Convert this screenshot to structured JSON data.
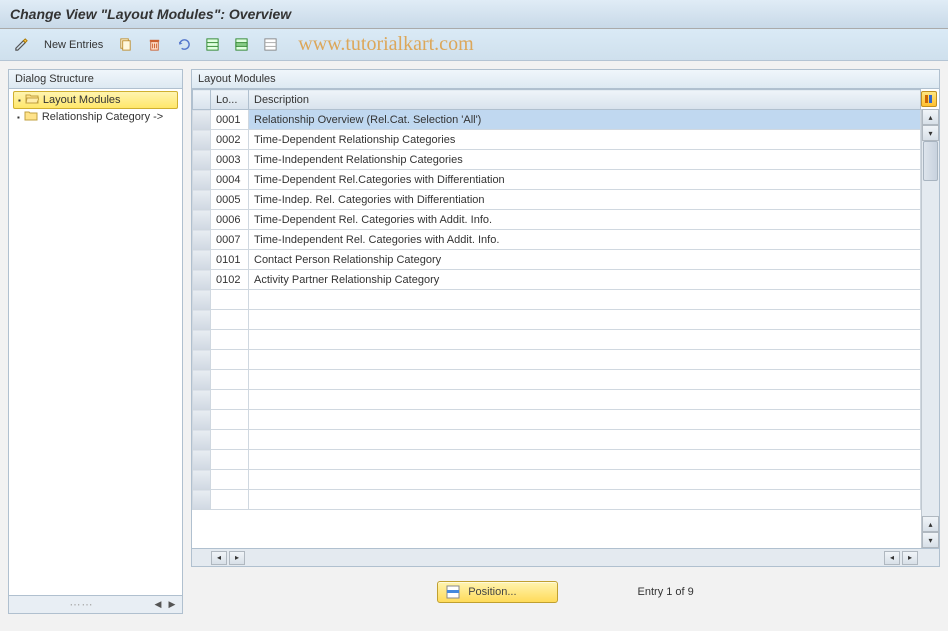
{
  "titlebar": {
    "text": "Change View \"Layout Modules\": Overview"
  },
  "toolbar": {
    "new_entries_label": "New Entries"
  },
  "watermark": "www.tutorialkart.com",
  "dialog_structure": {
    "header": "Dialog Structure",
    "items": [
      {
        "label": "Layout Modules",
        "selected": true,
        "open": true
      },
      {
        "label": "Relationship Category ->",
        "selected": false,
        "open": false
      }
    ]
  },
  "table": {
    "header": "Layout Modules",
    "columns": {
      "lo": "Lo...",
      "description": "Description"
    },
    "rows": [
      {
        "lo": "0001",
        "desc": "Relationship Overview (Rel.Cat. Selection 'All')",
        "selected": true
      },
      {
        "lo": "0002",
        "desc": "Time-Dependent Relationship Categories",
        "selected": false
      },
      {
        "lo": "0003",
        "desc": "Time-Independent Relationship Categories",
        "selected": false
      },
      {
        "lo": "0004",
        "desc": "Time-Dependent Rel.Categories with Differentiation",
        "selected": false
      },
      {
        "lo": "0005",
        "desc": "Time-Indep. Rel. Categories with Differentiation",
        "selected": false
      },
      {
        "lo": "0006",
        "desc": "Time-Dependent Rel. Categories with Addit. Info.",
        "selected": false
      },
      {
        "lo": "0007",
        "desc": "Time-Independent Rel. Categories with Addit. Info.",
        "selected": false
      },
      {
        "lo": "0101",
        "desc": "Contact Person Relationship Category",
        "selected": false
      },
      {
        "lo": "0102",
        "desc": "Activity Partner Relationship Category",
        "selected": false
      }
    ],
    "blank_rows": 11
  },
  "footer": {
    "position_label": "Position...",
    "entry_text": "Entry 1 of 9"
  }
}
